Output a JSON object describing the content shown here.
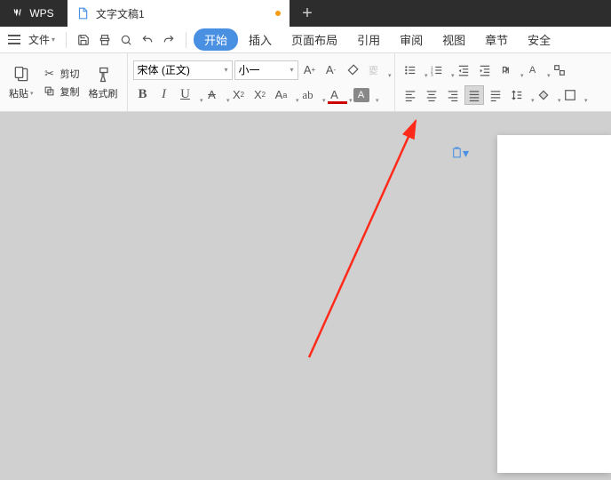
{
  "titlebar": {
    "brand": "WPS",
    "tab_label": "文字文稿1",
    "newtab_glyph": "+"
  },
  "menubar": {
    "file_label": "文件",
    "items": [
      "开始",
      "插入",
      "页面布局",
      "引用",
      "审阅",
      "视图",
      "章节",
      "安全"
    ]
  },
  "ribbon": {
    "clipboard": {
      "paste": "粘贴",
      "cut": "剪切",
      "copy": "复制",
      "format_painter": "格式刷"
    },
    "font": {
      "name": "宋体 (正文)",
      "size": "小一"
    }
  },
  "icons": {
    "increase_font": "A⁺",
    "decrease_font": "A⁻",
    "bold": "B",
    "italic": "I",
    "underline": "U",
    "strike": "A",
    "super": "X",
    "sub": "X",
    "clear": "◇",
    "fontcolor": "A",
    "highlight": "A"
  }
}
